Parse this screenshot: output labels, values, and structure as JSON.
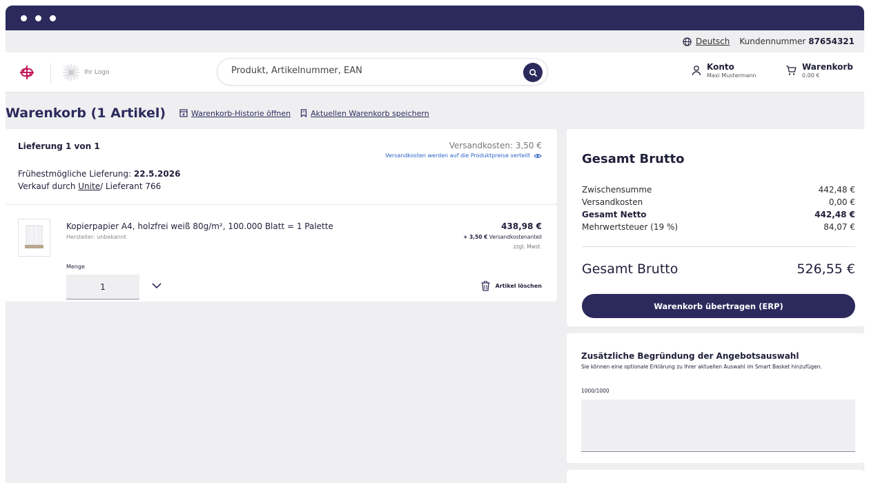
{
  "topbar": {
    "language": "Deutsch",
    "customer_label": "Kundennummer",
    "customer_number": "87654321"
  },
  "header": {
    "logo_placeholder": "Ihr Logo",
    "search_placeholder": "Produkt, Artikelnummer, EAN",
    "account_label": "Konto",
    "account_name": "Maxi Mustermann",
    "cart_label": "Warenkorb",
    "cart_total": "0,00 €"
  },
  "page": {
    "title": "Warenkorb (1 Artikel)",
    "history_link": "Warenkorb-Historie öffnen",
    "save_link": "Aktuellen Warenkorb speichern"
  },
  "delivery": {
    "heading": "Lieferung 1 von 1",
    "shipping_cost": "Versandkosten: 3,50 €",
    "shipping_note": "Versandkosten werden auf die Produktpreise verteilt",
    "earliest_label": "Frühestmögliche Lieferung:",
    "earliest_date": "22.5.2026",
    "seller_prefix": "Verkauf durch",
    "seller_name": "Unite",
    "seller_suffix": "/ Lieferant 766"
  },
  "item": {
    "name": "Kopierpapier A4, holzfrei weiß 80g/m², 100.000 Blatt = 1 Palette",
    "manufacturer": "Hersteller: unbekannt",
    "price": "438,98 €",
    "shipping_share_amount": "+ 3,50 €",
    "shipping_share_label": "Versandkostenanteil",
    "tax_note": "zzgl. Mwst.",
    "quantity_label": "Menge",
    "quantity": "1",
    "delete_label": "Artikel löschen"
  },
  "summary": {
    "heading": "Gesamt Brutto",
    "rows": [
      {
        "label": "Zwischensumme",
        "value": "442,48 €"
      },
      {
        "label": "Versandkosten",
        "value": "0,00 €"
      },
      {
        "label": "Gesamt Netto",
        "value": "442,48 €"
      },
      {
        "label": "Mehrwertsteuer (19 %)",
        "value": "84,07 €"
      }
    ],
    "total_label": "Gesamt Brutto",
    "total_value": "526,55 €",
    "button_label": "Warenkorb übertragen (ERP)"
  },
  "reason": {
    "heading": "Zusätzliche Begründung der Angebotsauswahl",
    "description": "Sie können eine optionale Erklärung zu Ihrer aktuellen Auswahl im Smart Basket hinzufügen.",
    "counter": "1000/1000"
  },
  "colors": {
    "primary": "#2c2a5c",
    "brand_logo": "#c2185b",
    "link_blue": "#2a64c8",
    "background": "#efeff1"
  },
  "icons": [
    "globe-icon",
    "brand-logo-icon",
    "search-icon",
    "user-icon",
    "cart-icon",
    "history-icon",
    "bookmark-icon",
    "eye-icon",
    "chevron-down-icon",
    "trash-icon"
  ]
}
